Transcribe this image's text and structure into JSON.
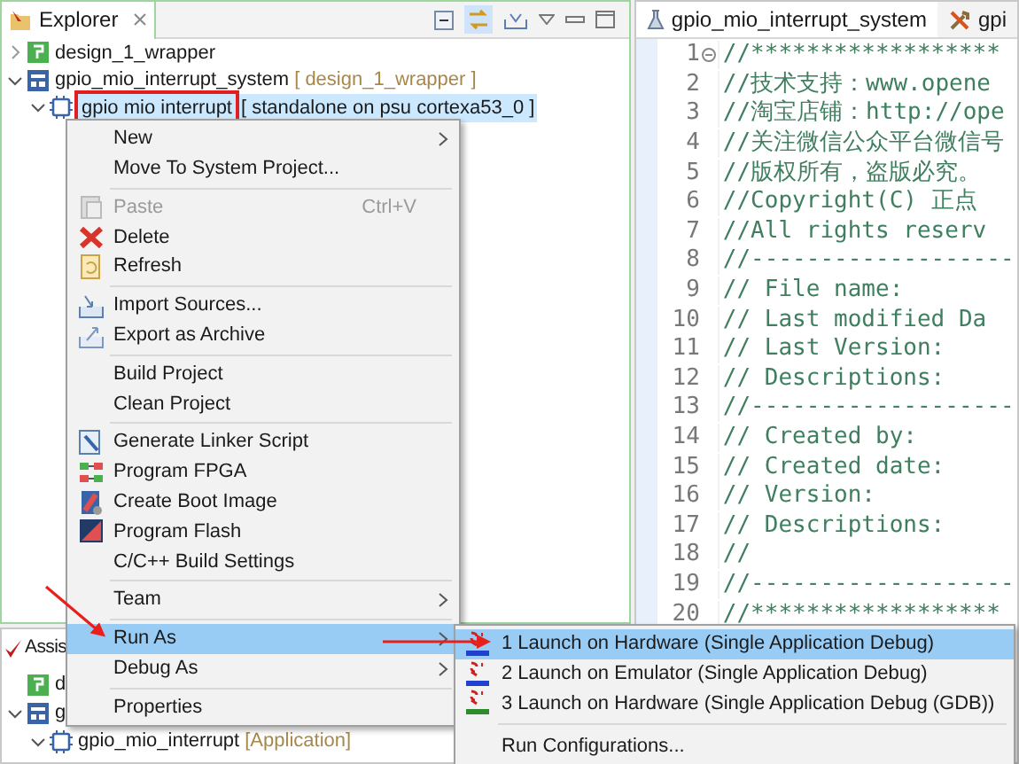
{
  "explorer": {
    "title": "Explorer",
    "tree": [
      {
        "label": "design_1_wrapper",
        "expanded": false,
        "selected": false,
        "annotated": false,
        "kind": "hardware"
      },
      {
        "label": "gpio_mio_interrupt_system",
        "decoration": "[ design_1_wrapper ]",
        "expanded": true,
        "selected": false,
        "annotated": false,
        "kind": "system",
        "children": [
          {
            "label": "gpio mio interrupt",
            "decoration": "[ standalone on psu cortexa53_0 ]",
            "expanded": true,
            "selected": true,
            "annotated": true,
            "kind": "application"
          }
        ]
      }
    ]
  },
  "assistant": {
    "title": "Assis",
    "tree": [
      {
        "label": "d",
        "kind": "hardware"
      },
      {
        "label": "g",
        "expanded": true,
        "kind": "system",
        "children": [
          {
            "label": "gpio_mio_interrupt",
            "decoration": "[Application]",
            "expanded": true,
            "kind": "application"
          }
        ]
      }
    ]
  },
  "editor": {
    "tabs": [
      {
        "label": "gpio_mio_interrupt_system",
        "selected": true
      },
      {
        "label": "gpi",
        "selected": false
      }
    ],
    "lines": [
      {
        "number": "1",
        "text": "//******************",
        "folded": false
      },
      {
        "number": "2",
        "text": "//技术支持：www.opene"
      },
      {
        "number": "3",
        "text": "//淘宝店铺：http://ope"
      },
      {
        "number": "4",
        "text": "//关注微信公众平台微信号"
      },
      {
        "number": "5",
        "text": "//版权所有，盗版必究。"
      },
      {
        "number": "6",
        "text": "//Copyright(C) 正点"
      },
      {
        "number": "7",
        "text": "//All rights reserv"
      },
      {
        "number": "8",
        "text": "//-------------------"
      },
      {
        "number": "9",
        "text": "// File name:"
      },
      {
        "number": "10",
        "text": "// Last modified Da"
      },
      {
        "number": "11",
        "text": "// Last Version:"
      },
      {
        "number": "12",
        "text": "// Descriptions:"
      },
      {
        "number": "13",
        "text": "//-------------------"
      },
      {
        "number": "14",
        "text": "// Created by:"
      },
      {
        "number": "15",
        "text": "// Created date:"
      },
      {
        "number": "16",
        "text": "// Version:"
      },
      {
        "number": "17",
        "text": "// Descriptions:"
      },
      {
        "number": "18",
        "text": "//"
      },
      {
        "number": "19",
        "text": "//-------------------"
      },
      {
        "number": "20",
        "text": "//******************"
      }
    ]
  },
  "context_menu": {
    "items": [
      {
        "kind": "item",
        "label": "New",
        "submenu": true,
        "disabled": false,
        "selected": false
      },
      {
        "kind": "item",
        "label": "Move To System Project...",
        "submenu": false,
        "disabled": false,
        "selected": false
      },
      {
        "kind": "separator"
      },
      {
        "kind": "item",
        "label": "Paste",
        "shortcut": "Ctrl+V",
        "submenu": false,
        "disabled": true,
        "selected": false
      },
      {
        "kind": "item",
        "label": "Delete",
        "submenu": false,
        "disabled": false,
        "selected": false
      },
      {
        "kind": "item",
        "label": "Refresh",
        "submenu": false,
        "disabled": false,
        "selected": false
      },
      {
        "kind": "separator"
      },
      {
        "kind": "item",
        "label": "Import Sources...",
        "submenu": false,
        "disabled": false,
        "selected": false
      },
      {
        "kind": "item",
        "label": "Export as Archive",
        "submenu": false,
        "disabled": false,
        "selected": false
      },
      {
        "kind": "separator"
      },
      {
        "kind": "item",
        "label": "Build Project",
        "submenu": false,
        "disabled": false,
        "selected": false
      },
      {
        "kind": "item",
        "label": "Clean Project",
        "submenu": false,
        "disabled": false,
        "selected": false
      },
      {
        "kind": "separator"
      },
      {
        "kind": "item",
        "label": "Generate Linker Script",
        "submenu": false,
        "disabled": false,
        "selected": false
      },
      {
        "kind": "item",
        "label": "Program FPGA",
        "submenu": false,
        "disabled": false,
        "selected": false
      },
      {
        "kind": "item",
        "label": "Create Boot Image",
        "submenu": false,
        "disabled": false,
        "selected": false
      },
      {
        "kind": "item",
        "label": "Program Flash",
        "submenu": false,
        "disabled": false,
        "selected": false
      },
      {
        "kind": "item",
        "label": "C/C++ Build Settings",
        "submenu": false,
        "disabled": false,
        "selected": false
      },
      {
        "kind": "separator"
      },
      {
        "kind": "item",
        "label": "Team",
        "submenu": true,
        "disabled": false,
        "selected": false
      },
      {
        "kind": "separator"
      },
      {
        "kind": "item",
        "label": "Run As",
        "submenu": true,
        "disabled": false,
        "selected": true
      },
      {
        "kind": "item",
        "label": "Debug As",
        "submenu": true,
        "disabled": false,
        "selected": false
      },
      {
        "kind": "separator"
      },
      {
        "kind": "item",
        "label": "Properties",
        "submenu": false,
        "disabled": false,
        "selected": false
      }
    ]
  },
  "run_as_menu": {
    "items": [
      {
        "kind": "item",
        "label": "1 Launch on Hardware (Single Application Debug)",
        "selected": true
      },
      {
        "kind": "item",
        "label": "2 Launch on Emulator (Single Application Debug)",
        "selected": false
      },
      {
        "kind": "item",
        "label": "3 Launch on Hardware (Single Application Debug (GDB))",
        "selected": false
      },
      {
        "kind": "separator"
      },
      {
        "kind": "item",
        "label": "Run Configurations...",
        "selected": false
      }
    ]
  }
}
